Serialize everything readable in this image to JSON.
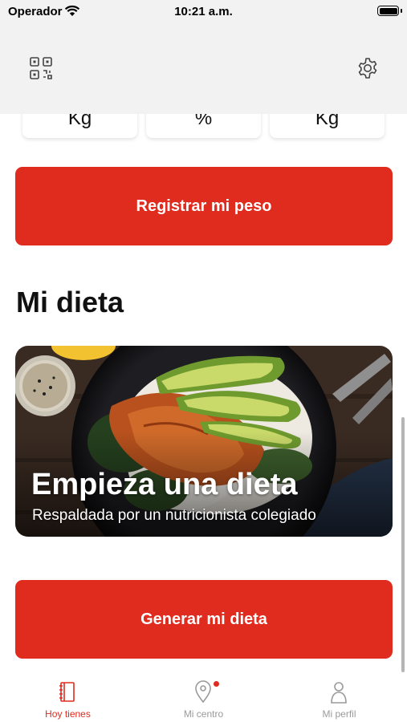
{
  "status_bar": {
    "carrier": "Operador",
    "time": "10:21 a.m."
  },
  "toolbar": {
    "qr_icon": "qr-code-icon",
    "settings_icon": "gear-icon"
  },
  "stats": [
    {
      "unit": "Kg"
    },
    {
      "unit": "%"
    },
    {
      "unit": "Kg"
    }
  ],
  "register_weight_button": "Registrar mi peso",
  "diet_section": {
    "title": "Mi dieta",
    "card": {
      "title": "Empieza una dieta",
      "subtitle": "Respaldada por un nutricionista colegiado"
    },
    "generate_button": "Generar mi dieta"
  },
  "tab_bar": {
    "tabs": [
      {
        "label": "Hoy tienes",
        "icon": "notebook-icon",
        "active": true
      },
      {
        "label": "Mi centro",
        "icon": "location-pin-icon",
        "badge": true
      },
      {
        "label": "Mi perfil",
        "icon": "person-icon"
      }
    ]
  },
  "colors": {
    "accent": "#e02b1f",
    "header_bg": "#f2f2f2",
    "inactive_tab": "#9a9a9a"
  }
}
